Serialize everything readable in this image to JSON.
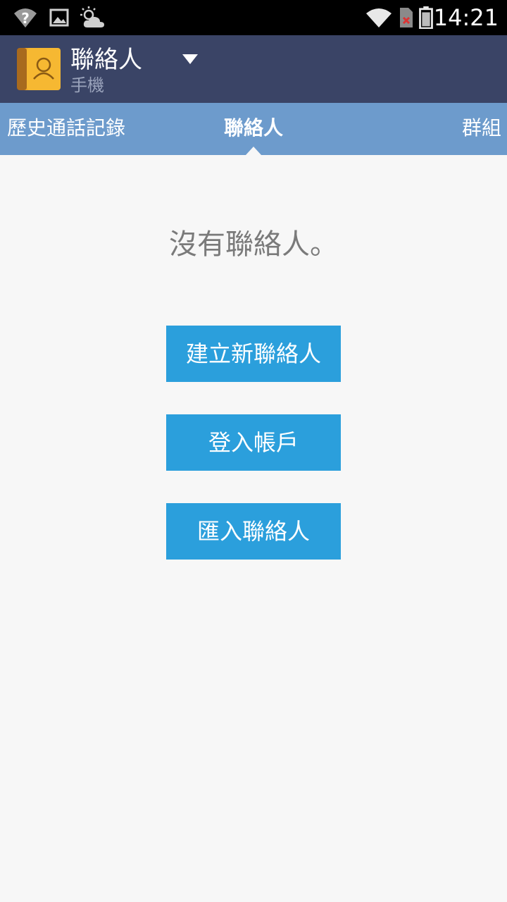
{
  "status_bar": {
    "time": "14:21",
    "icons": [
      "wifi-question-icon",
      "image-icon",
      "weather-partly-cloudy-icon",
      "wifi-signal-icon",
      "sim-missing-icon",
      "battery-icon"
    ]
  },
  "action_bar": {
    "title": "聯絡人",
    "subtitle": "手機",
    "app_icon": "contacts-book-icon",
    "accent_color": "#3a4466"
  },
  "tabs": [
    {
      "label": "歷史通話記錄",
      "selected": false
    },
    {
      "label": "聯絡人",
      "selected": true
    },
    {
      "label": "群組",
      "selected": false
    }
  ],
  "main": {
    "empty_message": "沒有聯絡人。",
    "buttons": [
      {
        "label": "建立新聯絡人"
      },
      {
        "label": "登入帳戶"
      },
      {
        "label": "匯入聯絡人"
      }
    ],
    "button_color": "#2b9fdc"
  }
}
